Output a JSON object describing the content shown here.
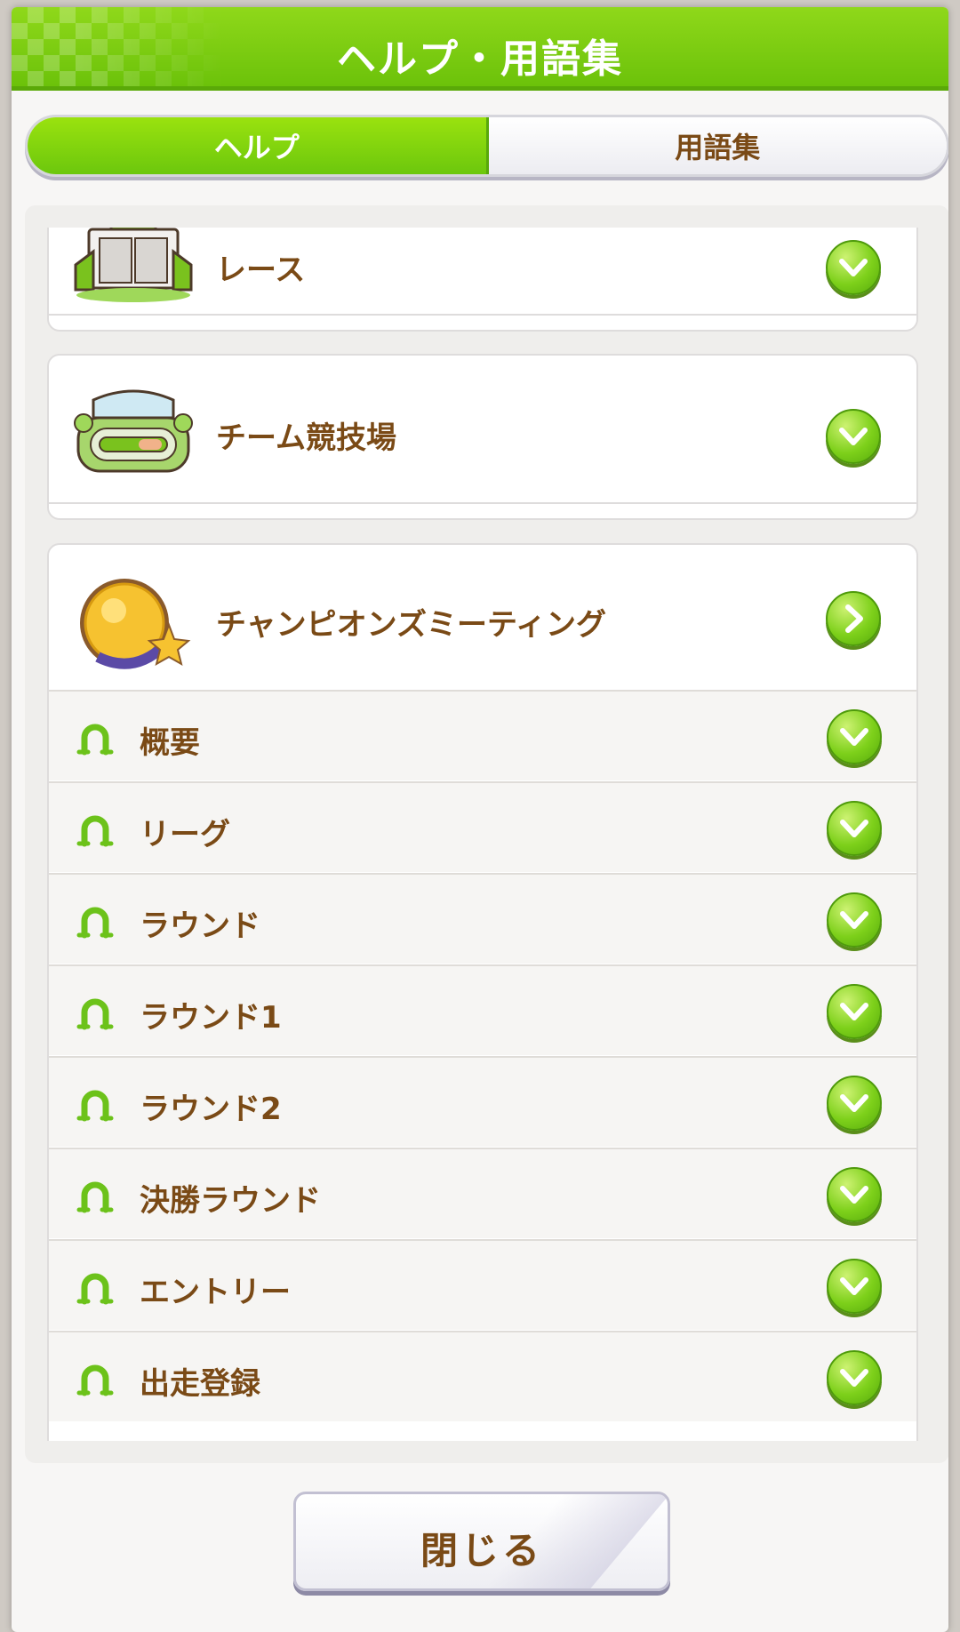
{
  "dialog": {
    "title": "ヘルプ・用語集"
  },
  "tabs": {
    "help": "ヘルプ",
    "glossary": "用語集"
  },
  "categories": [
    {
      "label": "レース",
      "state": "collapsed"
    },
    {
      "label": "チーム競技場",
      "state": "collapsed"
    },
    {
      "label": "チャンピオンズミーティング",
      "state": "expanded"
    }
  ],
  "subitems": [
    {
      "label": "概要"
    },
    {
      "label": "リーグ"
    },
    {
      "label": "ラウンド"
    },
    {
      "label": "ラウンド1"
    },
    {
      "label": "ラウンド2"
    },
    {
      "label": "決勝ラウンド"
    },
    {
      "label": "エントリー"
    },
    {
      "label": "出走登録"
    }
  ],
  "footer": {
    "close_label": "閉じる"
  },
  "colors": {
    "accent": "#7dd01a",
    "text": "#7a4a16"
  }
}
